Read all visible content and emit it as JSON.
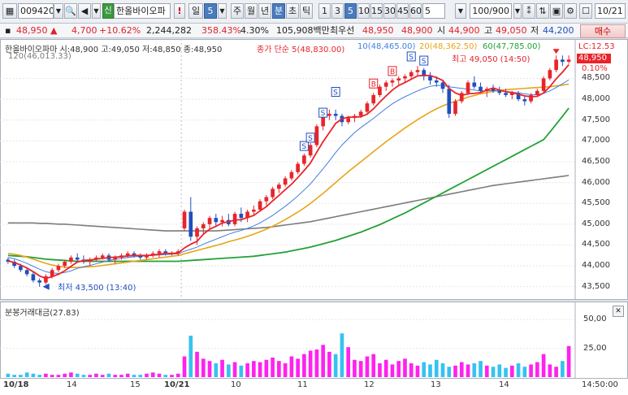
{
  "toolbar": {
    "code": "009420",
    "name": "한올바이오파",
    "shin_badge": "신",
    "alert_label": "!",
    "period_day": "일",
    "period_count": "5",
    "periods": [
      "주",
      "월",
      "년",
      "분",
      "초",
      "틱"
    ],
    "selected_period": "분",
    "intervals": [
      "1",
      "3",
      "5",
      "10",
      "15",
      "30",
      "45",
      "60"
    ],
    "selected_interval": "5",
    "count_value": "5",
    "zoom_value": "100/900",
    "date": "10/21"
  },
  "quote": {
    "price": "48,950",
    "change": "4,700",
    "change_pct": "+10.62%",
    "volume": "2,244,282",
    "vol_ratio": "358.43%",
    "turnover": "4.30%",
    "amount": "105,908백만",
    "priority_label": "최우선",
    "best_ask": "48,950",
    "best_bid": "48,900",
    "open_label": "시",
    "open": "44,900",
    "high_label": "고",
    "high": "49,050",
    "low_label": "저",
    "low": "44,200",
    "buy_button": "매수"
  },
  "price_panel": {
    "info": "한올바이오파마 시:48,900 고:49,050 저:48,850 종:48,950",
    "legend_close": "종가 단순 5(48,830.00)",
    "legend_ma10": "10(48,465.00)",
    "legend_ma20": "20(48,362.50)",
    "legend_ma60": "60(47,785.00)",
    "legend_ma120": "120(46,013.33)",
    "lc_label": "LC:12.53",
    "current_price": "48,950",
    "current_pct": "0.10%",
    "high_annotation": "최고 49,050 (14:50)",
    "low_annotation": "최저 43,500 (13:40)",
    "yticks": [
      "48,500",
      "48,000",
      "47,500",
      "47,000",
      "46,500",
      "46,000",
      "45,500",
      "45,000",
      "44,500",
      "44,000",
      "43,500"
    ],
    "colors": {
      "up": "#e8242a",
      "down": "#1f4fbf",
      "ma5": "#e8242a",
      "ma10": "#3f7fe0",
      "ma20": "#e8a417",
      "ma60": "#23a136",
      "ma120": "#7c7c7c"
    }
  },
  "volume_panel": {
    "legend": "분봉거래대금(27.83)",
    "yticks": [
      "50,00",
      "25,00"
    ],
    "colors": {
      "bar": "#ff22ee",
      "bar_alt": "#35c3f0"
    }
  },
  "xaxis": {
    "labels": [
      "10/18",
      "14",
      "15",
      "10/21",
      "10",
      "11",
      "12",
      "13",
      "14"
    ],
    "time": "14:50:00"
  },
  "chart_data": {
    "type": "candlestick",
    "ylim": [
      43300,
      49250
    ],
    "candles": [
      [
        44150,
        44200,
        44050,
        44100
      ],
      [
        44100,
        44150,
        43950,
        44000
      ],
      [
        44000,
        44050,
        43850,
        43900
      ],
      [
        43900,
        43950,
        43750,
        43800
      ],
      [
        43800,
        43850,
        43600,
        43650
      ],
      [
        43650,
        43700,
        43500,
        43600
      ],
      [
        43600,
        43800,
        43550,
        43750
      ],
      [
        43750,
        43950,
        43700,
        43900
      ],
      [
        43900,
        44050,
        43850,
        44000
      ],
      [
        44000,
        44150,
        43950,
        44100
      ],
      [
        44100,
        44250,
        44050,
        44200
      ],
      [
        44200,
        44300,
        44100,
        44150
      ],
      [
        44150,
        44250,
        44050,
        44100
      ],
      [
        44100,
        44200,
        44000,
        44150
      ],
      [
        44150,
        44250,
        44100,
        44200
      ],
      [
        44200,
        44300,
        44150,
        44250
      ],
      [
        44250,
        44300,
        44100,
        44150
      ],
      [
        44150,
        44250,
        44050,
        44200
      ],
      [
        44200,
        44300,
        44150,
        44250
      ],
      [
        44250,
        44350,
        44200,
        44300
      ],
      [
        44300,
        44350,
        44200,
        44250
      ],
      [
        44250,
        44300,
        44150,
        44200
      ],
      [
        44200,
        44300,
        44150,
        44250
      ],
      [
        44250,
        44350,
        44200,
        44300
      ],
      [
        44300,
        44400,
        44200,
        44350
      ],
      [
        44350,
        44400,
        44250,
        44300
      ],
      [
        44300,
        44350,
        44250,
        44300
      ],
      [
        44300,
        44400,
        44250,
        44350
      ],
      [
        44900,
        45350,
        44850,
        45300
      ],
      [
        45300,
        45650,
        44600,
        44700
      ],
      [
        44700,
        44950,
        44500,
        44900
      ],
      [
        44900,
        45050,
        44750,
        45000
      ],
      [
        45000,
        45200,
        44900,
        45150
      ],
      [
        45150,
        45250,
        44950,
        45050
      ],
      [
        45050,
        45200,
        44950,
        45100
      ],
      [
        45100,
        45250,
        44950,
        45000
      ],
      [
        45000,
        45300,
        44950,
        45250
      ],
      [
        45250,
        45400,
        45050,
        45150
      ],
      [
        45150,
        45350,
        45050,
        45300
      ],
      [
        45300,
        45450,
        45200,
        45350
      ],
      [
        45350,
        45600,
        45300,
        45550
      ],
      [
        45550,
        45700,
        45450,
        45650
      ],
      [
        45650,
        45900,
        45600,
        45850
      ],
      [
        45850,
        46000,
        45750,
        45950
      ],
      [
        45950,
        46150,
        45900,
        46100
      ],
      [
        46100,
        46300,
        46050,
        46250
      ],
      [
        46250,
        46500,
        46200,
        46450
      ],
      [
        46450,
        46700,
        46400,
        46650
      ],
      [
        46650,
        46950,
        46600,
        46900
      ],
      [
        46900,
        47400,
        46850,
        47350
      ],
      [
        47350,
        47650,
        47250,
        47600
      ],
      [
        47600,
        47750,
        47500,
        47650
      ],
      [
        47650,
        47750,
        47500,
        47600
      ],
      [
        47600,
        47650,
        47350,
        47450
      ],
      [
        47450,
        47600,
        47400,
        47550
      ],
      [
        47550,
        47650,
        47450,
        47600
      ],
      [
        47600,
        47750,
        47550,
        47700
      ],
      [
        47700,
        47950,
        47650,
        47900
      ],
      [
        47900,
        48150,
        47850,
        48100
      ],
      [
        48100,
        48350,
        48050,
        48300
      ],
      [
        48300,
        48450,
        48200,
        48400
      ],
      [
        48400,
        48500,
        48300,
        48450
      ],
      [
        48450,
        48550,
        48350,
        48500
      ],
      [
        48500,
        48600,
        48400,
        48550
      ],
      [
        48550,
        48700,
        48500,
        48650
      ],
      [
        48650,
        48800,
        48550,
        48700
      ],
      [
        48700,
        48750,
        48450,
        48550
      ],
      [
        48550,
        48650,
        48350,
        48450
      ],
      [
        48450,
        48550,
        48300,
        48400
      ],
      [
        48400,
        48450,
        48150,
        48250
      ],
      [
        48250,
        48350,
        47550,
        47650
      ],
      [
        47650,
        48000,
        47600,
        47950
      ],
      [
        47950,
        48200,
        47900,
        48150
      ],
      [
        48150,
        48450,
        48100,
        48400
      ],
      [
        48400,
        48550,
        48250,
        48300
      ],
      [
        48300,
        48400,
        48150,
        48200
      ],
      [
        48200,
        48300,
        48050,
        48250
      ],
      [
        48250,
        48350,
        48150,
        48200
      ],
      [
        48200,
        48300,
        48100,
        48150
      ],
      [
        48150,
        48250,
        48050,
        48100
      ],
      [
        48100,
        48200,
        48000,
        48150
      ],
      [
        48150,
        48200,
        47950,
        48000
      ],
      [
        48000,
        48100,
        47850,
        47950
      ],
      [
        47950,
        48150,
        47900,
        48100
      ],
      [
        48100,
        48250,
        48050,
        48200
      ],
      [
        48200,
        48550,
        48150,
        48500
      ],
      [
        48500,
        48750,
        48450,
        48700
      ],
      [
        48700,
        49050,
        48650,
        48950
      ],
      [
        48950,
        49050,
        48800,
        48900
      ],
      [
        48900,
        49050,
        48850,
        48950
      ]
    ],
    "volumes": [
      3,
      2,
      2,
      4,
      3,
      2,
      3,
      2,
      2,
      3,
      4,
      3,
      2,
      2,
      3,
      2,
      3,
      2,
      2,
      3,
      2,
      2,
      3,
      4,
      3,
      2,
      2,
      3,
      18,
      36,
      22,
      16,
      14,
      12,
      15,
      11,
      13,
      10,
      12,
      14,
      13,
      15,
      17,
      14,
      12,
      18,
      16,
      20,
      23,
      24,
      28,
      22,
      20,
      38,
      26,
      15,
      14,
      18,
      20,
      12,
      15,
      11,
      14,
      16,
      12,
      10,
      13,
      11,
      15,
      12,
      9,
      10,
      13,
      11,
      12,
      14,
      10,
      9,
      11,
      8,
      10,
      12,
      9,
      11,
      13,
      20,
      11,
      9,
      14,
      27
    ],
    "ma5": [
      44120,
      44080,
      44020,
      43950,
      43860,
      43760,
      43700,
      43740,
      43800,
      43880,
      43990,
      44090,
      44130,
      44140,
      44160,
      44180,
      44200,
      44210,
      44220,
      44240,
      44250,
      44250,
      44250,
      44260,
      44280,
      44300,
      44300,
      44310,
      44430,
      44520,
      44590,
      44760,
      44880,
      44950,
      45030,
      45060,
      45100,
      45110,
      45160,
      45210,
      45320,
      45420,
      45560,
      45690,
      45830,
      45960,
      46120,
      46290,
      46470,
      46730,
      46980,
      47200,
      47420,
      47530,
      47570,
      47570,
      47580,
      47640,
      47770,
      47930,
      48080,
      48220,
      48330,
      48400,
      48480,
      48560,
      48570,
      48570,
      48520,
      48450,
      48260,
      48150,
      48090,
      48130,
      48140,
      48160,
      48220,
      48270,
      48220,
      48180,
      48160,
      48120,
      48080,
      48060,
      48070,
      48150,
      48300,
      48490,
      48650,
      48830
    ],
    "ma10": [
      44200,
      44170,
      44120,
      44060,
      43990,
      43920,
      43860,
      43830,
      43820,
      43840,
      43880,
      43940,
      43980,
      44010,
      44050,
      44090,
      44130,
      44160,
      44180,
      44200,
      44220,
      44230,
      44240,
      44250,
      44260,
      44270,
      44280,
      44290,
      44350,
      44400,
      44450,
      44520,
      44580,
      44640,
      44700,
      44760,
      44810,
      44850,
      44900,
      44960,
      45030,
      45120,
      45210,
      45320,
      45430,
      45550,
      45680,
      45820,
      45970,
      46150,
      46330,
      46520,
      46720,
      46900,
      47050,
      47200,
      47320,
      47430,
      47540,
      47660,
      47780,
      47890,
      47980,
      48060,
      48130,
      48200,
      48260,
      48310,
      48330,
      48330,
      48300,
      48280,
      48260,
      48240,
      48220,
      48200,
      48200,
      48210,
      48200,
      48190,
      48170,
      48150,
      48130,
      48110,
      48110,
      48140,
      48200,
      48280,
      48370,
      48465
    ],
    "ma20": [
      44300,
      44280,
      44250,
      44210,
      44160,
      44110,
      44060,
      44020,
      43990,
      43970,
      43960,
      43960,
      43970,
      43980,
      43990,
      44010,
      44030,
      44050,
      44070,
      44090,
      44110,
      44130,
      44150,
      44170,
      44190,
      44210,
      44230,
      44250,
      44290,
      44330,
      44370,
      44410,
      44450,
      44490,
      44530,
      44580,
      44620,
      44660,
      44710,
      44760,
      44820,
      44880,
      44950,
      45030,
      45110,
      45200,
      45290,
      45390,
      45500,
      45620,
      45740,
      45870,
      46000,
      46130,
      46260,
      46380,
      46500,
      46620,
      46740,
      46860,
      46980,
      47090,
      47200,
      47310,
      47410,
      47510,
      47600,
      47690,
      47770,
      47840,
      47900,
      47950,
      48000,
      48050,
      48090,
      48130,
      48160,
      48190,
      48210,
      48230,
      48240,
      48250,
      48260,
      48270,
      48280,
      48290,
      48300,
      48320,
      48340,
      48362
    ],
    "ma60": [
      44250,
      44240,
      44230,
      44220,
      44200,
      44180,
      44160,
      44150,
      44140,
      44130,
      44120,
      44110,
      44110,
      44110,
      44110,
      44110,
      44110,
      44110,
      44110,
      44110,
      44110,
      44110,
      44110,
      44110,
      44110,
      44110,
      44110,
      44110,
      44120,
      44130,
      44140,
      44150,
      44160,
      44170,
      44180,
      44190,
      44200,
      44210,
      44220,
      44230,
      44250,
      44270,
      44290,
      44310,
      44330,
      44360,
      44390,
      44420,
      44450,
      44490,
      44530,
      44570,
      44610,
      44660,
      44710,
      44760,
      44810,
      44870,
      44930,
      44990,
      45060,
      45130,
      45200,
      45270,
      45350,
      45430,
      45510,
      45590,
      45670,
      45750,
      45830,
      45910,
      45990,
      46070,
      46150,
      46230,
      46310,
      46390,
      46470,
      46550,
      46630,
      46710,
      46790,
      46870,
      46950,
      47030,
      47210,
      47400,
      47590,
      47785
    ],
    "ma120": [
      45030,
      45030,
      45030,
      45030,
      45030,
      45020,
      45020,
      45010,
      45000,
      45000,
      44990,
      44980,
      44970,
      44960,
      44950,
      44940,
      44930,
      44920,
      44910,
      44900,
      44890,
      44880,
      44870,
      44860,
      44850,
      44840,
      44840,
      44840,
      44840,
      44840,
      44840,
      44840,
      44840,
      44840,
      44850,
      44860,
      44870,
      44880,
      44890,
      44900,
      44910,
      44920,
      44940,
      44960,
      44980,
      45000,
      45020,
      45040,
      45060,
      45090,
      45120,
      45150,
      45180,
      45210,
      45240,
      45270,
      45300,
      45330,
      45360,
      45390,
      45420,
      45450,
      45480,
      45510,
      45540,
      45570,
      45600,
      45630,
      45660,
      45690,
      45720,
      45750,
      45780,
      45810,
      45840,
      45870,
      45900,
      45930,
      45950,
      45970,
      45990,
      46010,
      46030,
      46050,
      46070,
      46090,
      46110,
      46130,
      46150,
      46170
    ]
  }
}
